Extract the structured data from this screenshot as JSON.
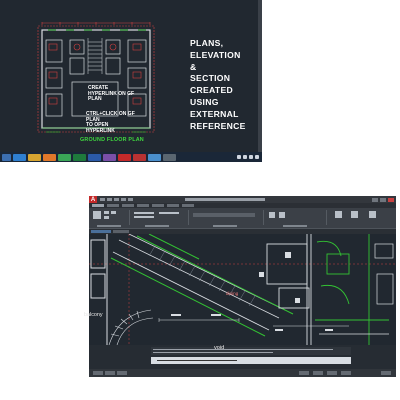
{
  "top_screenshot": {
    "overlay_title": "PLANS,\nELEVATION\n&\nSECTION\nCREATED\nUSING\nEXTERNAL\nREFERENCE",
    "hint_create": "CREATE\nHYPERLINK ON GF\nPLAN",
    "hint_open": "CTRL+CLICK ON GF\nPLAN\nTO OPEN\nHYPERLINK",
    "plan_caption": "GROUND FLOOR PLAN",
    "taskbar_icons": [
      "start-icon",
      "ie-icon",
      "explorer-icon",
      "media-icon",
      "chrome-icon",
      "excel-icon",
      "word-icon",
      "app-icon",
      "autocad-icon",
      "pdf-icon",
      "app-icon",
      "app-icon"
    ]
  },
  "bottom_screenshot": {
    "room_labels": {
      "balcony": "balcony",
      "dining": "dining",
      "void": "void"
    }
  },
  "colors": {
    "canvas_bg": "#212830",
    "plan_line_white": "#d9dde2",
    "plan_line_red": "#d04040",
    "plan_line_green": "#33c233",
    "title_text": "#ffffff",
    "caption_green": "#3fd83f",
    "taskbar": "#1a2738"
  }
}
